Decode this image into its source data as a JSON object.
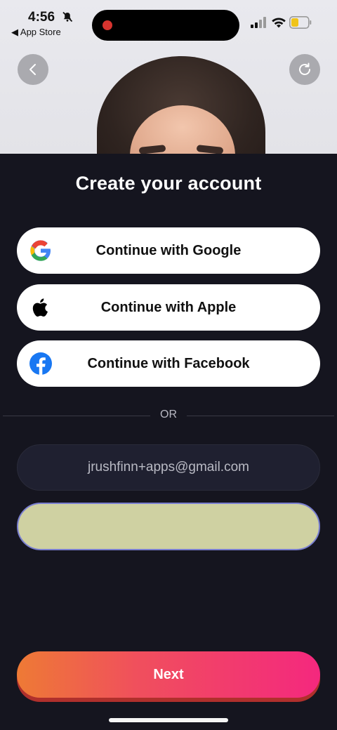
{
  "status_bar": {
    "time": "4:56",
    "back_label": "◀ App Store"
  },
  "page": {
    "title": "Create your account"
  },
  "social": {
    "google_label": "Continue with Google",
    "apple_label": "Continue with Apple",
    "facebook_label": "Continue with Facebook"
  },
  "divider": {
    "text": "OR"
  },
  "form": {
    "email_value": "jrushfinn+apps@gmail.com",
    "password_value": ""
  },
  "actions": {
    "next_label": "Next"
  },
  "colors": {
    "background": "#15151f",
    "accent_start": "#ee7a35",
    "accent_end": "#f4287e",
    "focus_border": "#7a7fd0"
  }
}
